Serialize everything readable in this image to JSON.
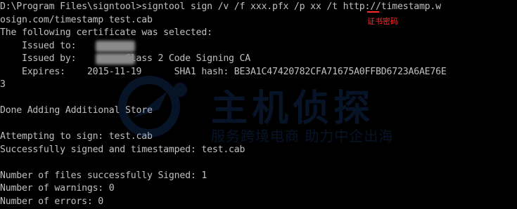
{
  "console": {
    "lines": [
      "D:\\Program Files\\signtool>signtool sign /v /f xxx.pfx /p xx /t http://timestamp.w",
      "osign.com/timestamp test.cab",
      "The following certificate was selected:",
      "    Issued to:",
      "    Issued by:         Class 2 Code Signing CA",
      "    Expires:    2015-11-19      SHA1 hash: BE3A1C47420782CFA71675A0FFBD6723A6AE76E",
      "3",
      "",
      "Done Adding Additional Store",
      "",
      "Attempting to sign: test.cab",
      "Successfully signed and timestamped: test.cab",
      "",
      "Number of files successfully Signed: 1",
      "Number of warnings: 0",
      "Number of errors: 0"
    ]
  },
  "annotation": {
    "text": "证书密码",
    "color": "#ff2a2a"
  },
  "watermark": {
    "title": "主机侦探",
    "subtitle": "服务跨境电商 助力中企出海"
  },
  "colors": {
    "background": "#000000",
    "text": "#c0c0c0",
    "watermark": "#2b6fd6"
  }
}
